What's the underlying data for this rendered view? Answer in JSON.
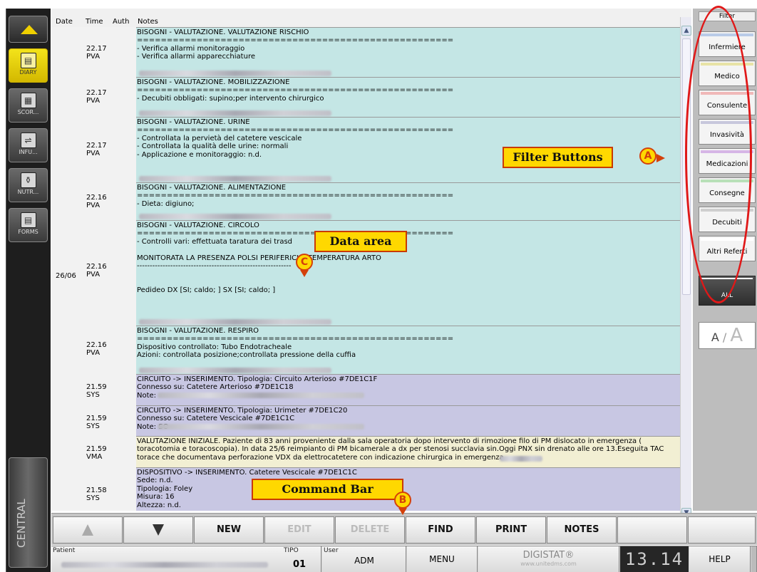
{
  "sidebar": {
    "items": [
      {
        "label": "DIARY",
        "icon": "diary-icon"
      },
      {
        "label": "SCOR...",
        "icon": "scores-icon"
      },
      {
        "label": "INFU...",
        "icon": "infusion-icon"
      },
      {
        "label": "NUTR...",
        "icon": "nutrition-icon"
      },
      {
        "label": "FORMS",
        "icon": "forms-icon"
      }
    ],
    "central": "CENTRAL"
  },
  "table": {
    "headers": {
      "date": "Date",
      "time": "Time",
      "auth": "Auth",
      "notes": "Notes"
    },
    "date_value": "26/06",
    "rows": [
      {
        "time": "22.17 PVA",
        "type": "bisogni",
        "lines": [
          "BISOGNI - VALUTAZIONE. VALUTAZIONE RISCHIO",
          "=====================================================",
          "- Verifica allarmi monitoraggio",
          "- Verifica allarmi apparecchiature"
        ]
      },
      {
        "time": "22.17 PVA",
        "type": "bisogni",
        "lines": [
          "BISOGNI - VALUTAZIONE. MOBILIZZAZIONE",
          "=====================================================",
          "- Decubiti obbligati: supino;per intervento chirurgico"
        ]
      },
      {
        "time": "22.17 PVA",
        "type": "bisogni",
        "lines": [
          "BISOGNI - VALUTAZIONE. URINE",
          "=====================================================",
          "- Controllata la pervietà del catetere vescicale",
          "- Controllata la qualità delle urine: normali",
          "- Applicazione e monitoraggio: n.d."
        ]
      },
      {
        "time": "22.16 PVA",
        "type": "bisogni",
        "lines": [
          "BISOGNI - VALUTAZIONE. ALIMENTAZIONE",
          "=====================================================",
          "- Dieta: digiuno;"
        ]
      },
      {
        "time": "22.16 PVA",
        "type": "bisogni",
        "lines": [
          "BISOGNI - VALUTAZIONE. CIRCOLO",
          "=====================================================",
          "- Controlli vari: effettuata taratura dei trasd",
          "",
          "MONITORATA LA PRESENZA POLSI PERIFERICI E TEMPERATURA ARTO",
          "------------------------------------------------------------",
          "",
          "",
          "Pedideo DX [SI; caldo; ] SX [SI; caldo; ]"
        ]
      },
      {
        "time": "22.16 PVA",
        "type": "bisogni",
        "lines": [
          "BISOGNI - VALUTAZIONE. RESPIRO",
          "=====================================================",
          "Dispositivo controllato: Tubo Endotracheale",
          "Azioni: controllata posizione;controllata pressione della cuffia"
        ]
      },
      {
        "time": "21.59 SYS",
        "type": "circuito",
        "lines": [
          "CIRCUITO -> INSERIMENTO. Tipologia: Circuito Arterioso #7DE1C1F",
          "Connesso su: Catetere Arterioso #7DE1C18",
          "Note:"
        ]
      },
      {
        "time": "21.59 SYS",
        "type": "circuito",
        "lines": [
          "CIRCUITO -> INSERIMENTO. Tipologia: Urimeter #7DE1C20",
          "Connesso su: Catetere Vescicale #7DE1C1C",
          "Note: SO"
        ]
      },
      {
        "time": "21.59 VMA",
        "type": "valutazione",
        "lines": [
          "VALUTAZIONE INIZIALE. Paziente di 83 anni proveniente dalla sala operatoria dopo intervento di rimozione filo di PM dislocato in emergenza ( toracotomia e toracoscopia). In data 25/6 reimpianto di PM bicamerale a dx per stenosi succlavia sin.Oggi PNX sin drenato alle ore 13.Eseguita TAC torace che documentava perforazione VDX da elettrocatetere con indicazione chirurgica in emergenza."
        ]
      },
      {
        "time": "21.58 SYS",
        "type": "dispositivo",
        "lines": [
          "DISPOSITIVO -> INSERIMENTO. Catetere Vescicale #7DE1C1C",
          "Sede: n.d.",
          "Tipologia: Foley",
          "Misura: 16",
          "Altezza: n.d."
        ]
      }
    ]
  },
  "filters": {
    "title": "Filter",
    "buttons": [
      {
        "label": "Infermiere",
        "color": "#b9cbe8"
      },
      {
        "label": "Medico",
        "color": "#e8e3a6"
      },
      {
        "label": "Consulente",
        "color": "#f0b8b8"
      },
      {
        "label": "Invasività",
        "color": "#c7c7dc"
      },
      {
        "label": "Medicazioni",
        "color": "#d6b5e6"
      },
      {
        "label": "Consegne",
        "color": "#b8e0b8"
      },
      {
        "label": "Decubiti",
        "color": "#cfcfcf"
      },
      {
        "label": "Altri Referti",
        "color": "#ffffff"
      }
    ],
    "all_label": "ALL",
    "font_toggle": {
      "small": "A",
      "sep": "/",
      "big": "A"
    }
  },
  "commands": {
    "new": "NEW",
    "edit": "EDIT",
    "delete": "DELETE",
    "find": "FIND",
    "print": "PRINT",
    "notes": "NOTES"
  },
  "status": {
    "patient_label": "Patient",
    "tipo_label": "TIPO",
    "tipo_value": "01",
    "user_label": "User",
    "user_value": "ADM",
    "menu": "MENU",
    "brand": "DIGISTAT®",
    "brand_url": "www.unitedms.com",
    "clock": "13.14",
    "help": "HELP"
  },
  "annotations": {
    "filter_buttons": {
      "marker": "A",
      "label": "Filter Buttons"
    },
    "command_bar": {
      "marker": "B",
      "label": "Command Bar"
    },
    "data_area": {
      "marker": "C",
      "label": "Data area"
    }
  }
}
